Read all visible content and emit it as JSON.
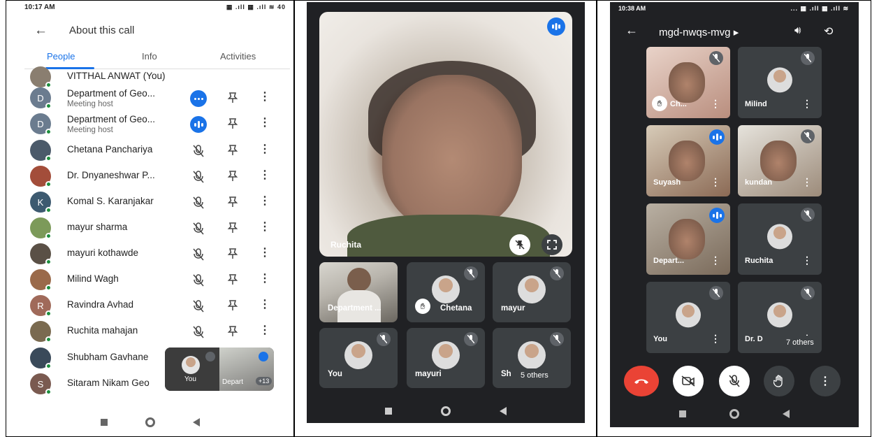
{
  "panel1": {
    "status_time": "10:17 AM",
    "status_icons": "▦ .ıll ▦ .ıll ≋ 40",
    "title": "About this call",
    "tabs": [
      "People",
      "Info",
      "Activities"
    ],
    "participants": [
      {
        "name": "VITTHAL ANWAT (You)",
        "initial": "",
        "avatar_color": "#8a7e70"
      },
      {
        "name": "Department of Geo...",
        "sub": "Meeting host",
        "initial": "D",
        "avatar_color": "#6b7c8f",
        "status": "more"
      },
      {
        "name": "Department of Geo...",
        "sub": "Meeting host",
        "initial": "D",
        "avatar_color": "#6b7c8f",
        "status": "speaking"
      },
      {
        "name": "Chetana Panchariya",
        "initial": "",
        "avatar_color": "#4b5a6a",
        "status": "muted"
      },
      {
        "name": "Dr. Dnyaneshwar P...",
        "initial": "",
        "avatar_color": "#a34d3a",
        "status": "muted"
      },
      {
        "name": "Komal S. Karanjakar",
        "initial": "K",
        "avatar_color": "#3d5a70",
        "status": "muted"
      },
      {
        "name": "mayur sharma",
        "initial": "",
        "avatar_color": "#7c9a5a",
        "status": "muted"
      },
      {
        "name": "mayuri kothawde",
        "initial": "",
        "avatar_color": "#5a5046",
        "status": "muted"
      },
      {
        "name": "Milind Wagh",
        "initial": "",
        "avatar_color": "#9a6a4a",
        "status": "muted"
      },
      {
        "name": "Ravindra Avhad",
        "initial": "R",
        "avatar_color": "#a06a5a",
        "status": "muted"
      },
      {
        "name": "Ruchita mahajan",
        "initial": "",
        "avatar_color": "#7a6a50",
        "status": "muted"
      },
      {
        "name": "Shubham Gavhane",
        "initial": "",
        "avatar_color": "#3a4a5a"
      },
      {
        "name": "Sitaram Nikam Geo",
        "initial": "S",
        "avatar_color": "#7a5a50"
      }
    ],
    "pip": {
      "you_label": "You",
      "dep_label": "Depart",
      "count": "+13"
    }
  },
  "panel2": {
    "main_name": "Ruchita",
    "tiles": [
      {
        "name": "Department ...",
        "type": "photo"
      },
      {
        "name": "Chetana",
        "type": "avatar",
        "hand": true
      },
      {
        "name": "mayur",
        "type": "avatar"
      },
      {
        "name": "You",
        "type": "avatar"
      },
      {
        "name": "mayuri",
        "type": "avatar"
      },
      {
        "name": "Sh",
        "type": "avatar"
      }
    ],
    "others_label": "5 others"
  },
  "panel3": {
    "status_time": "10:38 AM",
    "status_icons": "... ▦ .ıll ▦ .ıll ≋",
    "meeting_code": "mgd-nwqs-mvg ▸",
    "tiles": [
      {
        "name": "Ch...",
        "hand": true
      },
      {
        "name": "Milind"
      },
      {
        "name": "Suyash",
        "speaking": true
      },
      {
        "name": "kundan"
      },
      {
        "name": "Depart...",
        "speaking": true
      },
      {
        "name": "Ruchita"
      },
      {
        "name": "You"
      },
      {
        "name": "Dr. D"
      }
    ],
    "others_label": "7 others"
  },
  "colors": {
    "accent": "#1a73e8",
    "hangup": "#ea4335",
    "online": "#1e8e3e"
  }
}
